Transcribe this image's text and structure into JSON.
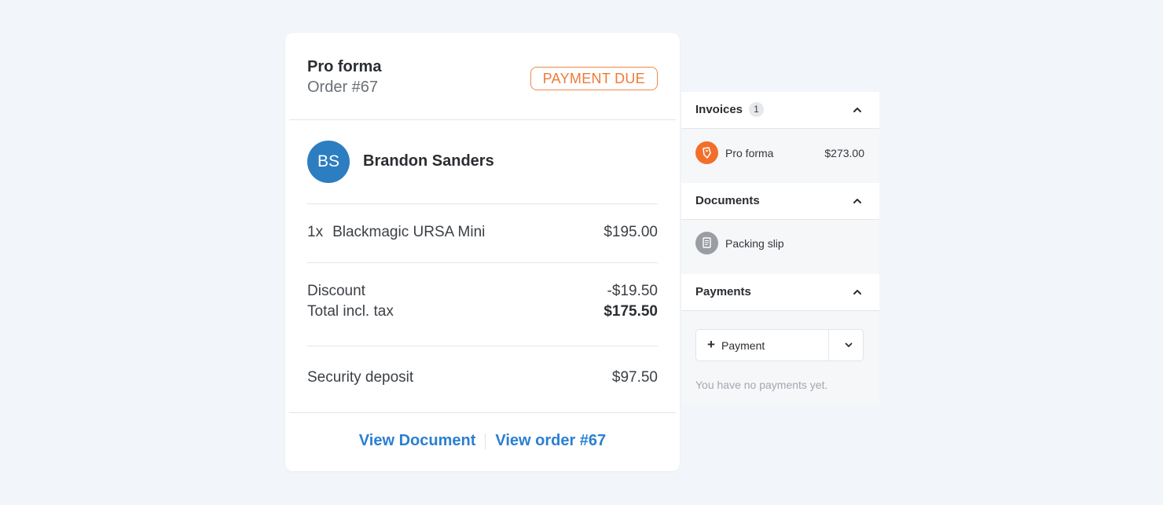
{
  "invoice": {
    "title": "Pro forma",
    "order_number": "Order #67",
    "status": "PAYMENT DUE",
    "customer": {
      "initials": "BS",
      "name": "Brandon Sanders"
    },
    "line_item": {
      "qty": "1x",
      "name": "Blackmagic URSA Mini",
      "amount": "$195.00"
    },
    "discount": {
      "label": "Discount",
      "value": "-$19.50"
    },
    "total": {
      "label": "Total incl. tax",
      "value": "$175.50"
    },
    "deposit": {
      "label": "Security deposit",
      "value": "$97.50"
    },
    "links": {
      "view_document": "View Document",
      "view_order": "View order #67"
    }
  },
  "sidebar": {
    "invoices": {
      "title": "Invoices",
      "count": "1",
      "items": [
        {
          "icon": "invoice-icon",
          "label": "Pro forma",
          "amount": "$273.00"
        }
      ]
    },
    "documents": {
      "title": "Documents",
      "items": [
        {
          "icon": "document-icon",
          "label": "Packing slip"
        }
      ]
    },
    "payments": {
      "title": "Payments",
      "button_icon": "+",
      "button_label": "Payment",
      "empty_text": "You have no payments yet."
    }
  },
  "colors": {
    "accent_orange": "#ee7a37",
    "avatar_blue": "#2d7ec0",
    "link_blue": "#2b7fd1",
    "background": "#f2f5f9"
  }
}
